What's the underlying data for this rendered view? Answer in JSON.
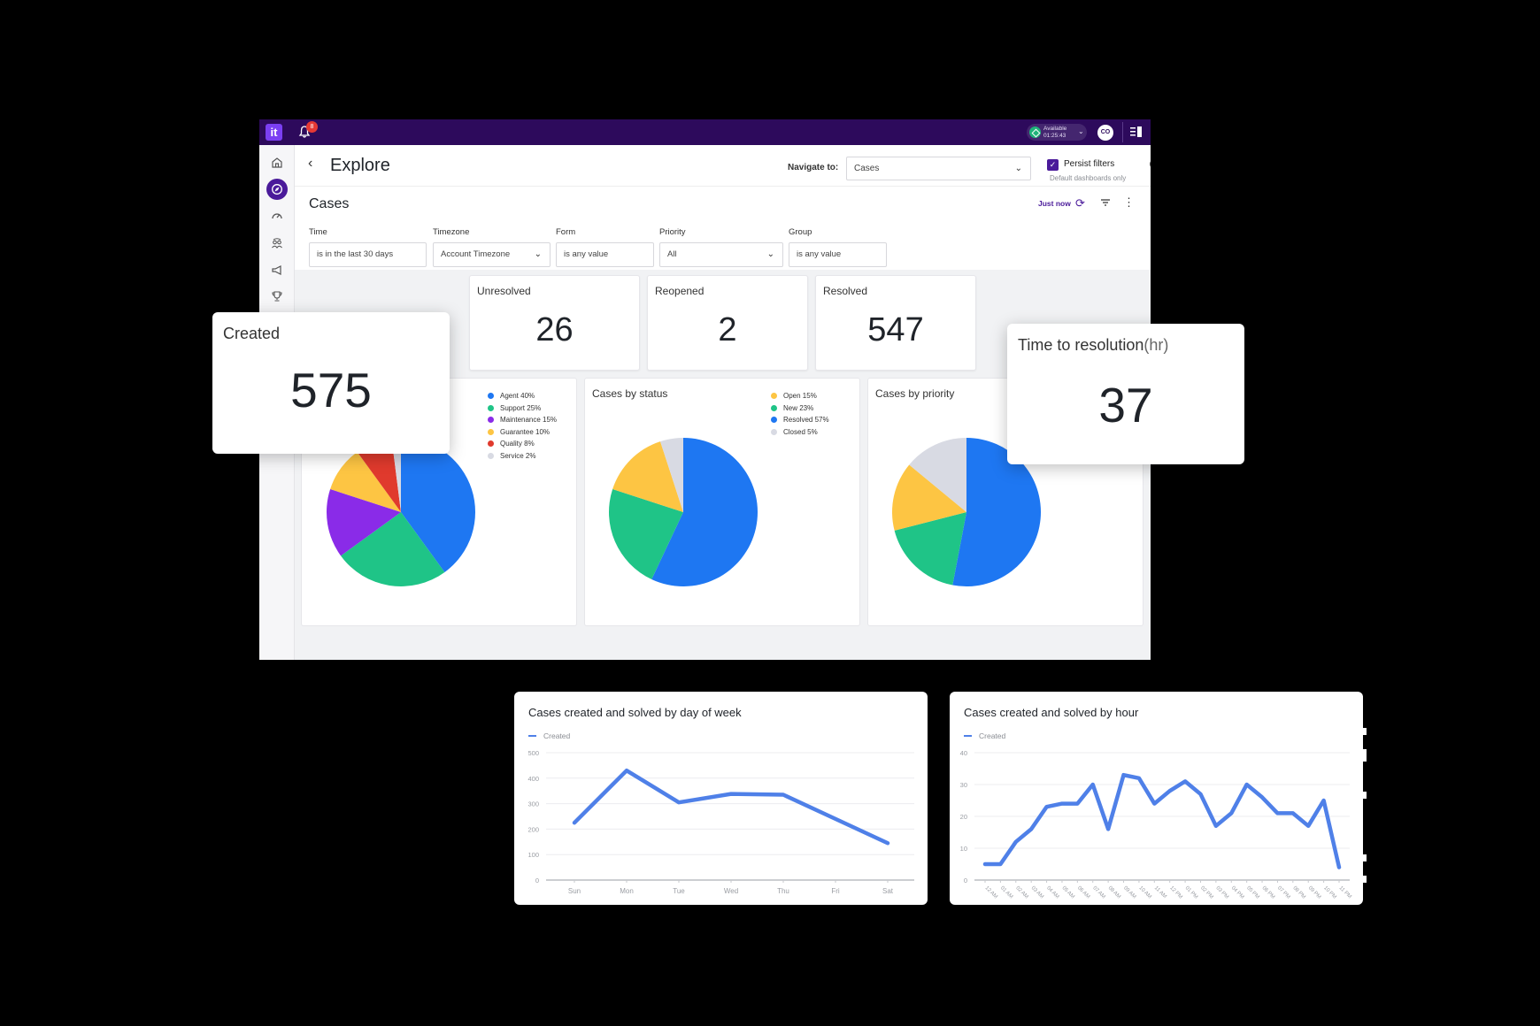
{
  "app": {
    "notification_count": "8",
    "status": {
      "label": "Available",
      "timer": "01:25:43"
    },
    "avatar_initials": "CO"
  },
  "sidebar": {
    "items": [
      {
        "name": "home",
        "active": false
      },
      {
        "name": "explore",
        "active": true
      },
      {
        "name": "dashboard",
        "active": false
      },
      {
        "name": "users",
        "active": false
      },
      {
        "name": "campaigns",
        "active": false
      },
      {
        "name": "achievements",
        "active": false
      }
    ]
  },
  "header": {
    "back_label": "‹",
    "title": "Explore",
    "navigate_label": "Navigate to:",
    "navigate_value": "Cases",
    "persist_label": "Persist filters",
    "persist_checked": true,
    "persist_sub": "Default dashboards only"
  },
  "filters": {
    "section_title": "Cases",
    "last_updated": "Just now",
    "fields": [
      {
        "label": "Time",
        "value": "is in the last 30 days",
        "dropdown": false
      },
      {
        "label": "Timezone",
        "value": "Account Timezone",
        "dropdown": true
      },
      {
        "label": "Form",
        "value": "is any value",
        "dropdown": false
      },
      {
        "label": "Priority",
        "value": "All",
        "dropdown": true
      },
      {
        "label": "Group",
        "value": "is any value",
        "dropdown": false
      }
    ]
  },
  "stats": {
    "created": {
      "label": "Created",
      "value": "575"
    },
    "unresolved": {
      "label": "Unresolved",
      "value": "26"
    },
    "reopened": {
      "label": "Reopened",
      "value": "2"
    },
    "resolved": {
      "label": "Resolved",
      "value": "547"
    },
    "time_to_resolution": {
      "label": "Time to resolution",
      "unit": "(hr)",
      "value": "37"
    }
  },
  "colors": {
    "brand_dark": "#2d0a5c",
    "brand": "#4a1a9a",
    "line": "#4f80e8"
  },
  "chart_data": [
    {
      "type": "pie",
      "title": "",
      "legend_position": "right",
      "slices": [
        {
          "label": "Agent",
          "value": 40,
          "legend": "Agent 40%",
          "color": "#1e77f2"
        },
        {
          "label": "Support",
          "value": 25,
          "legend": "Support 25%",
          "color": "#1fc487"
        },
        {
          "label": "Maintenance",
          "value": 15,
          "legend": "Maintenance 15%",
          "color": "#8a2be8"
        },
        {
          "label": "Guarantee",
          "value": 10,
          "legend": "Guarantee 10%",
          "color": "#fdc543"
        },
        {
          "label": "Quality",
          "value": 8,
          "legend": "Quality 8%",
          "color": "#e03a2d"
        },
        {
          "label": "Service",
          "value": 2,
          "legend": "Service 2%",
          "color": "#d8dae3"
        }
      ]
    },
    {
      "type": "pie",
      "title": "Cases by status",
      "legend_position": "right",
      "slices": [
        {
          "label": "Resolved",
          "value": 57,
          "legend": "Resolved 57%",
          "color": "#1e77f2"
        },
        {
          "label": "New",
          "value": 23,
          "legend": "New 23%",
          "color": "#1fc487"
        },
        {
          "label": "Open",
          "value": 15,
          "legend": "Open 15%",
          "color": "#fdc543"
        },
        {
          "label": "Closed",
          "value": 5,
          "legend": "Closed 5%",
          "color": "#d8dae3"
        }
      ],
      "legend_order": [
        "Open 15%",
        "New 23%",
        "Resolved 57%",
        "Closed 5%"
      ],
      "legend_colors": [
        "#fdc543",
        "#1fc487",
        "#1e77f2",
        "#d8dae3"
      ]
    },
    {
      "type": "pie",
      "title": "Cases by priority",
      "slices": [
        {
          "label": "Blue",
          "value": 53,
          "color": "#1e77f2"
        },
        {
          "label": "Green",
          "value": 18,
          "color": "#1fc487"
        },
        {
          "label": "Yellow",
          "value": 15,
          "color": "#fdc543"
        },
        {
          "label": "Grey",
          "value": 14,
          "color": "#d8dae3"
        }
      ]
    },
    {
      "type": "line",
      "title": "Cases created and solved by day of week",
      "legend": [
        "Created"
      ],
      "categories": [
        "Sun",
        "Mon",
        "Tue",
        "Wed",
        "Thu",
        "Fri",
        "Sat"
      ],
      "series": [
        {
          "name": "Created",
          "values": [
            225,
            430,
            305,
            338,
            335,
            240,
            145
          ]
        }
      ],
      "ylim": [
        0,
        500
      ],
      "yticks": [
        0,
        100,
        200,
        300,
        400,
        500
      ],
      "grid": true
    },
    {
      "type": "line",
      "title": "Cases created and solved by hour",
      "legend": [
        "Created"
      ],
      "categories": [
        "12 AM",
        "01 AM",
        "02 AM",
        "03 AM",
        "04 AM",
        "05 AM",
        "06 AM",
        "07 AM",
        "08 AM",
        "09 AM",
        "10 AM",
        "11 AM",
        "12 PM",
        "01 PM",
        "02 PM",
        "03 PM",
        "04 PM",
        "05 PM",
        "06 PM",
        "07 PM",
        "08 PM",
        "09 PM",
        "10 PM",
        "11 PM"
      ],
      "series": [
        {
          "name": "Created",
          "values": [
            5,
            5,
            12,
            16,
            23,
            24,
            24,
            30,
            16,
            33,
            32,
            24,
            28,
            31,
            27,
            17,
            21,
            30,
            26,
            21,
            21,
            17,
            25,
            4
          ]
        }
      ],
      "ylim": [
        0,
        40
      ],
      "yticks": [
        0,
        10,
        20,
        30,
        40
      ],
      "grid": true
    }
  ]
}
